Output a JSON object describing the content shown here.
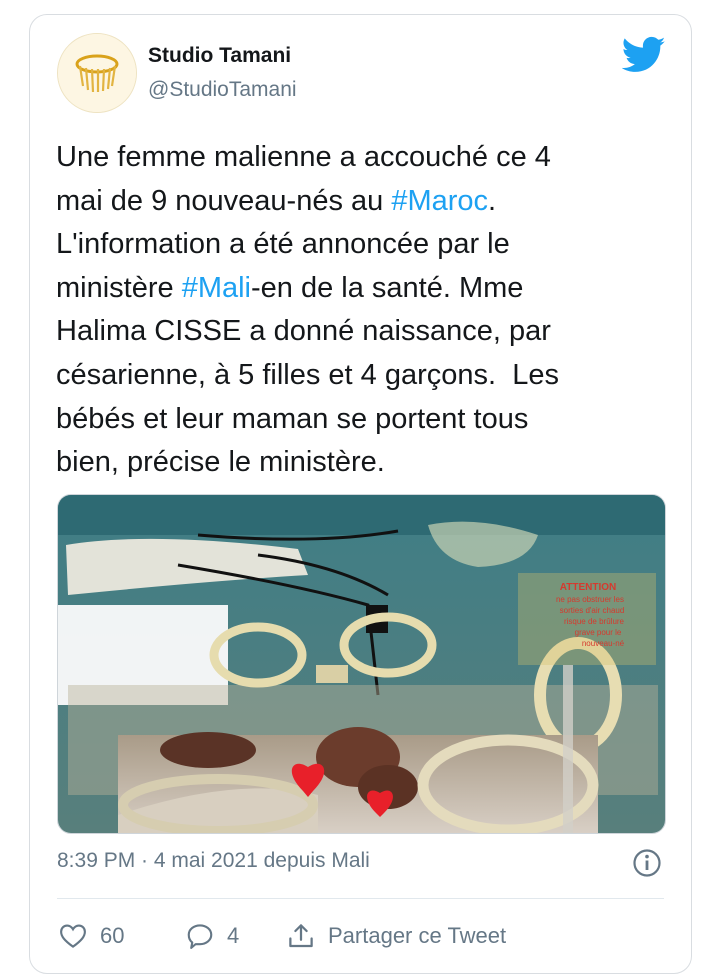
{
  "author": {
    "name": "Studio Tamani",
    "handle": "@StudioTamani"
  },
  "tweet": {
    "lines": [
      [
        {
          "text": "Une femme malienne a accouché ce 4"
        }
      ],
      [
        {
          "text": "mai de 9 nouveau-nés au "
        },
        {
          "text": "#Maroc",
          "hashtag": true
        },
        {
          "text": "."
        }
      ],
      [
        {
          "text": "L'information a été annoncée par le"
        }
      ],
      [
        {
          "text": "ministère "
        },
        {
          "text": "#Mali",
          "hashtag": true
        },
        {
          "text": "-en de la santé. Mme"
        }
      ],
      [
        {
          "text": "Halima CISSE a donné naissance, par"
        }
      ],
      [
        {
          "text": "césarienne, à 5 filles et 4 garçons.  Les"
        }
      ],
      [
        {
          "text": "bébés et leur maman se portent tous"
        }
      ],
      [
        {
          "text": "bien, précise le ministère."
        }
      ]
    ],
    "media_sign_text": [
      "ATTENTION",
      "ne pas obstruer les",
      "sorties d'air chaud",
      "risque de brûlure",
      "grave pour le",
      "nouveau-né"
    ],
    "meta": "8:39 PM · 4 mai 2021 depuis Mali"
  },
  "actions": {
    "like_count": "60",
    "reply_count": "4",
    "share_label": "Partager ce Tweet"
  },
  "colors": {
    "hashtag": "#1da1f2",
    "twitter_blue": "#1da1f2",
    "secondary_text": "#657786",
    "heart_sticker": "#e8202a"
  },
  "icons": [
    "twitter-bird-icon",
    "info-icon",
    "heart-icon",
    "reply-bubble-icon",
    "share-icon"
  ]
}
